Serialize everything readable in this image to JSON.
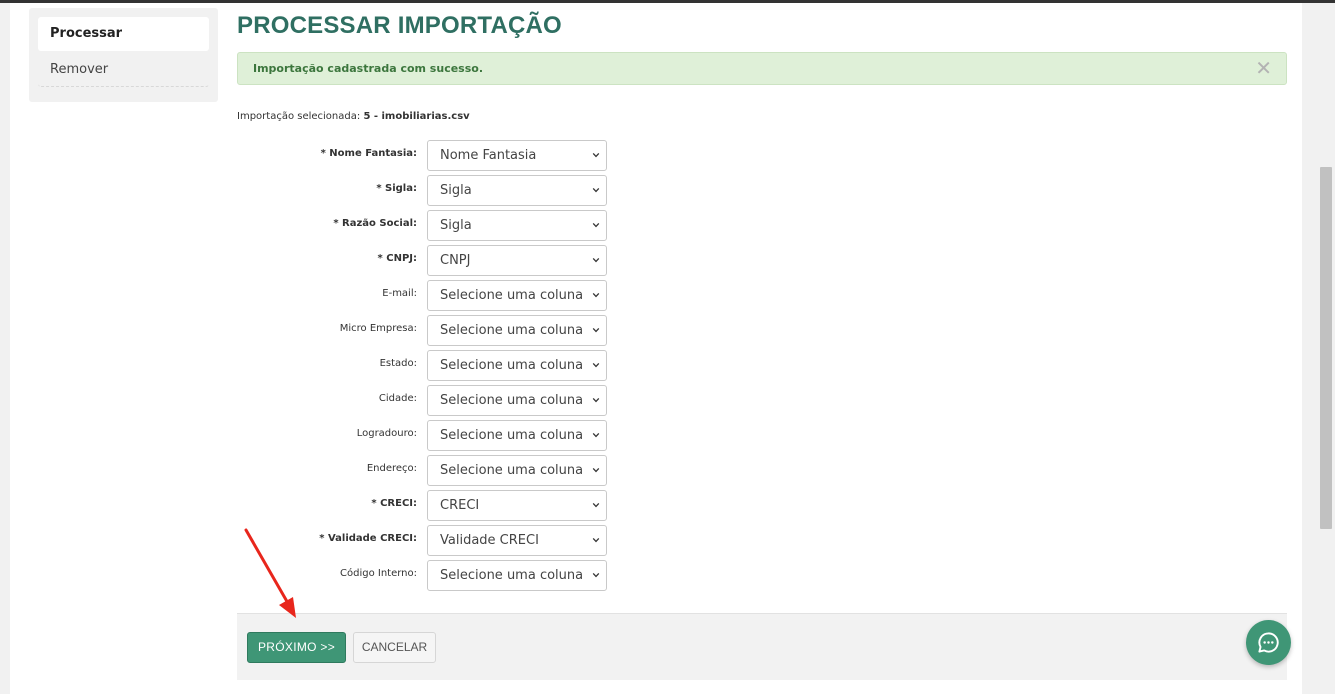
{
  "sidebar": {
    "items": [
      {
        "label": "Processar",
        "active": true
      },
      {
        "label": "Remover",
        "active": false
      }
    ]
  },
  "page": {
    "title": "PROCESSAR IMPORTAÇÃO"
  },
  "alert": {
    "message": "Importação cadastrada com sucesso.",
    "close_glyph": "✕",
    "color": "#dff0d8"
  },
  "selected_import": {
    "label": "Importação selecionada:",
    "value": "5 - imobiliarias.csv"
  },
  "fields": [
    {
      "label": "* Nome Fantasia:",
      "value": "Nome Fantasia",
      "required": true
    },
    {
      "label": "* Sigla:",
      "value": "Sigla",
      "required": true
    },
    {
      "label": "* Razão Social:",
      "value": "Sigla",
      "required": true
    },
    {
      "label": "* CNPJ:",
      "value": "CNPJ",
      "required": true
    },
    {
      "label": "E-mail:",
      "value": "Selecione uma coluna",
      "required": false
    },
    {
      "label": "Micro Empresa:",
      "value": "Selecione uma coluna",
      "required": false
    },
    {
      "label": "Estado:",
      "value": "Selecione uma coluna",
      "required": false
    },
    {
      "label": "Cidade:",
      "value": "Selecione uma coluna",
      "required": false
    },
    {
      "label": "Logradouro:",
      "value": "Selecione uma coluna",
      "required": false
    },
    {
      "label": "Endereço:",
      "value": "Selecione uma coluna",
      "required": false
    },
    {
      "label": "* CRECI:",
      "value": "CRECI",
      "required": true
    },
    {
      "label": "* Validade CRECI:",
      "value": "Validade CRECI",
      "required": true
    },
    {
      "label": "Código Interno:",
      "value": "Selecione uma coluna",
      "required": false
    }
  ],
  "actions": {
    "next_label": "PRÓXIMO >>",
    "cancel_label": "CANCELAR"
  },
  "colors": {
    "accent": "#3f9676",
    "title": "#2f6f62",
    "annotation_arrow": "#e8261c"
  },
  "icons": {
    "chat": "chat-bubble-icon",
    "select": "chevron-down-icon",
    "annotation": "red-arrow-annotation"
  }
}
